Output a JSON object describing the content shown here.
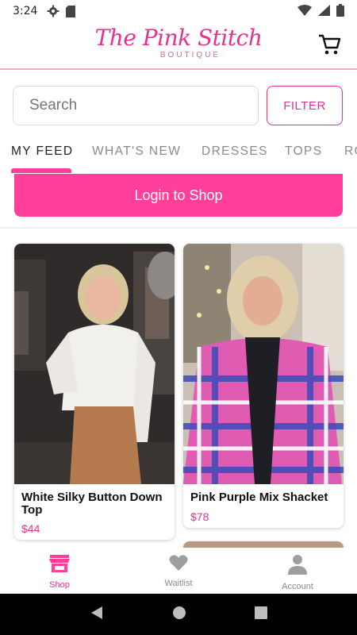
{
  "status_bar": {
    "time": "3:24",
    "icons": [
      "settings-icon",
      "sd-card-icon",
      "wifi-icon",
      "cell-signal-icon",
      "battery-icon"
    ]
  },
  "header": {
    "logo_script": "The Pink Stitch",
    "logo_sub": "BOUTIQUE",
    "cart_icon": "cart-icon"
  },
  "search": {
    "placeholder": "Search",
    "filter_label": "FILTER"
  },
  "tabs": [
    "MY FEED",
    "WHAT'S NEW",
    "DRESSES",
    "TOPS",
    "RO"
  ],
  "active_tab": "MY FEED",
  "login": {
    "label": "Login to Shop"
  },
  "products": [
    {
      "name": "White Silky Button Down Top",
      "price": "$44"
    },
    {
      "name": "Pink Purple Mix Shacket",
      "price": "$78"
    }
  ],
  "bottom_nav": [
    {
      "label": "Shop",
      "icon": "store-icon",
      "active": true
    },
    {
      "label": "Waitlist",
      "icon": "heart-icon",
      "active": false
    },
    {
      "label": "Account",
      "icon": "person-icon",
      "active": false
    }
  ],
  "colors": {
    "brand_pink": "#ff3f9a",
    "text_pink": "#e8318c",
    "header_rule": "#f4a6c9"
  }
}
